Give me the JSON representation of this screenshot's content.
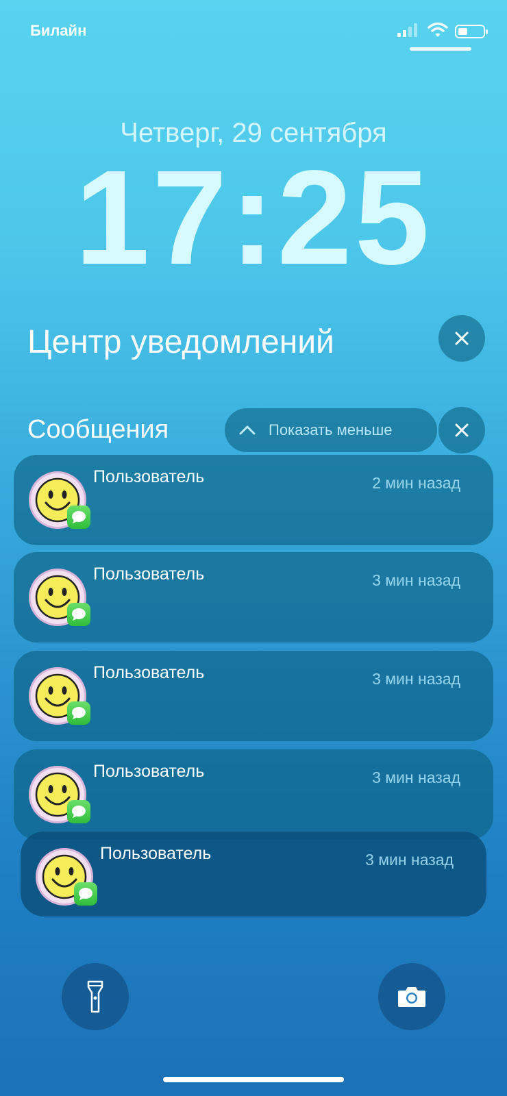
{
  "status_bar": {
    "carrier": "Билайн",
    "signal_icon": "cellular-signal-icon",
    "wifi_icon": "wifi-icon",
    "battery_icon": "battery-icon"
  },
  "lock_screen": {
    "date": "Четверг, 29 сентября",
    "time": "17:25"
  },
  "notification_center": {
    "title": "Центр уведомлений",
    "close_icon": "close-icon"
  },
  "group": {
    "title": "Сообщения",
    "show_less_label": "Показать меньше",
    "close_icon": "close-icon"
  },
  "notifications": [
    {
      "sender": "Пользователь",
      "time_ago": "2 мин назад",
      "app_icon": "messages-icon"
    },
    {
      "sender": "Пользователь",
      "time_ago": "3 мин назад",
      "app_icon": "messages-icon"
    },
    {
      "sender": "Пользователь",
      "time_ago": "3 мин назад",
      "app_icon": "messages-icon"
    },
    {
      "sender": "Пользователь",
      "time_ago": "3 мин назад",
      "app_icon": "messages-icon"
    },
    {
      "sender": "Пользователь",
      "time_ago": "3 мин назад",
      "app_icon": "messages-icon"
    }
  ],
  "bottom_controls": {
    "left_icon": "flashlight-icon",
    "right_icon": "camera-icon"
  },
  "colors": {
    "messages_green": "#34c759",
    "smiley_yellow": "#f5ec5a"
  }
}
